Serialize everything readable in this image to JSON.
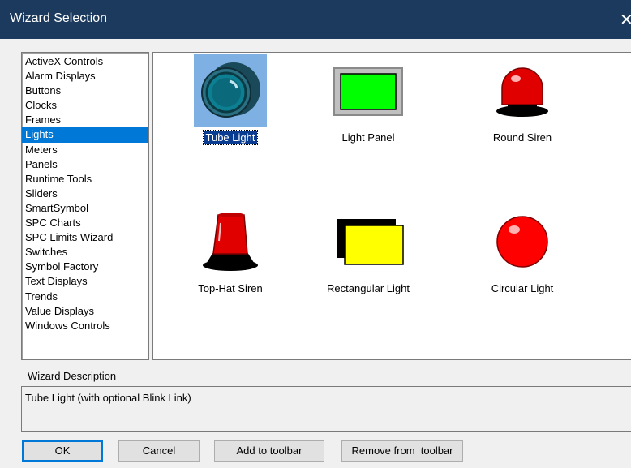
{
  "window": {
    "title": "Wizard Selection",
    "close_glyph": "✕"
  },
  "categories": [
    "ActiveX Controls",
    "Alarm Displays",
    "Buttons",
    "Clocks",
    "Frames",
    "Lights",
    "Meters",
    "Panels",
    "Runtime Tools",
    "Sliders",
    "SmartSymbol",
    "SPC Charts",
    "SPC Limits Wizard",
    "Switches",
    "Symbol Factory",
    "Text Displays",
    "Trends",
    "Value Displays",
    "Windows Controls"
  ],
  "selected_category": "Lights",
  "wizards": [
    {
      "label": "Tube Light",
      "icon": "tube-light-icon",
      "selected": true
    },
    {
      "label": "Light Panel",
      "icon": "light-panel-icon",
      "selected": false
    },
    {
      "label": "Round Siren",
      "icon": "round-siren-icon",
      "selected": false
    },
    {
      "label": "Top-Hat Siren",
      "icon": "top-hat-siren-icon",
      "selected": false
    },
    {
      "label": "Rectangular Light",
      "icon": "rectangular-light-icon",
      "selected": false
    },
    {
      "label": "Circular Light",
      "icon": "circular-light-icon",
      "selected": false
    }
  ],
  "description": {
    "heading": "Wizard Description",
    "text": "Tube Light (with optional Blink Link)"
  },
  "buttons": {
    "ok": "OK",
    "cancel": "Cancel",
    "add_toolbar": "Add to toolbar",
    "remove_toolbar": "Remove from  toolbar"
  },
  "colors": {
    "selection": "#0078d7",
    "titlebar": "#1c3a5e",
    "siren_red": "#ff0000",
    "panel_green": "#00ff00",
    "rect_yellow": "#ffff00"
  }
}
